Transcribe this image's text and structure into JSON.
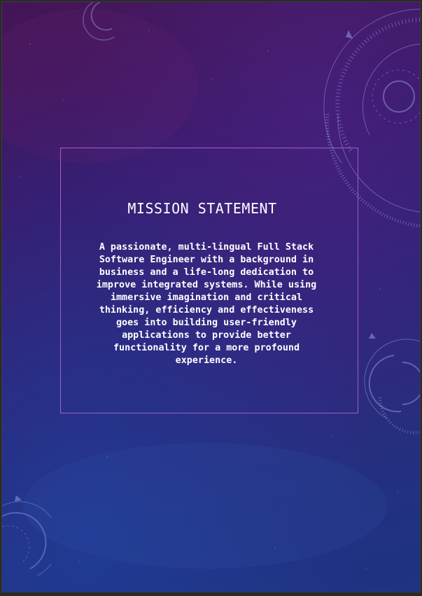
{
  "slide": {
    "title": "MISSION STATEMENT",
    "body": "A passionate, multi-lingual Full Stack\nSoftware Engineer with a background in\nbusiness and a life-long dedication to\nimprove integrated systems. While using\nimmersive imagination and critical\nthinking, efficiency and effectiveness\ngoes into building user-friendly\napplications to provide better\nfunctionality for a more profound\nexperience."
  },
  "colors": {
    "background_top": "#451555",
    "background_bottom": "#1d3383",
    "frame_border": "#a35ec9",
    "text": "#ffffff"
  },
  "decorations": {
    "background": "starfield-texture",
    "ornaments": [
      "hud-ring-icon",
      "hud-ring-icon",
      "hud-ring-icon",
      "hud-ring-icon"
    ]
  }
}
